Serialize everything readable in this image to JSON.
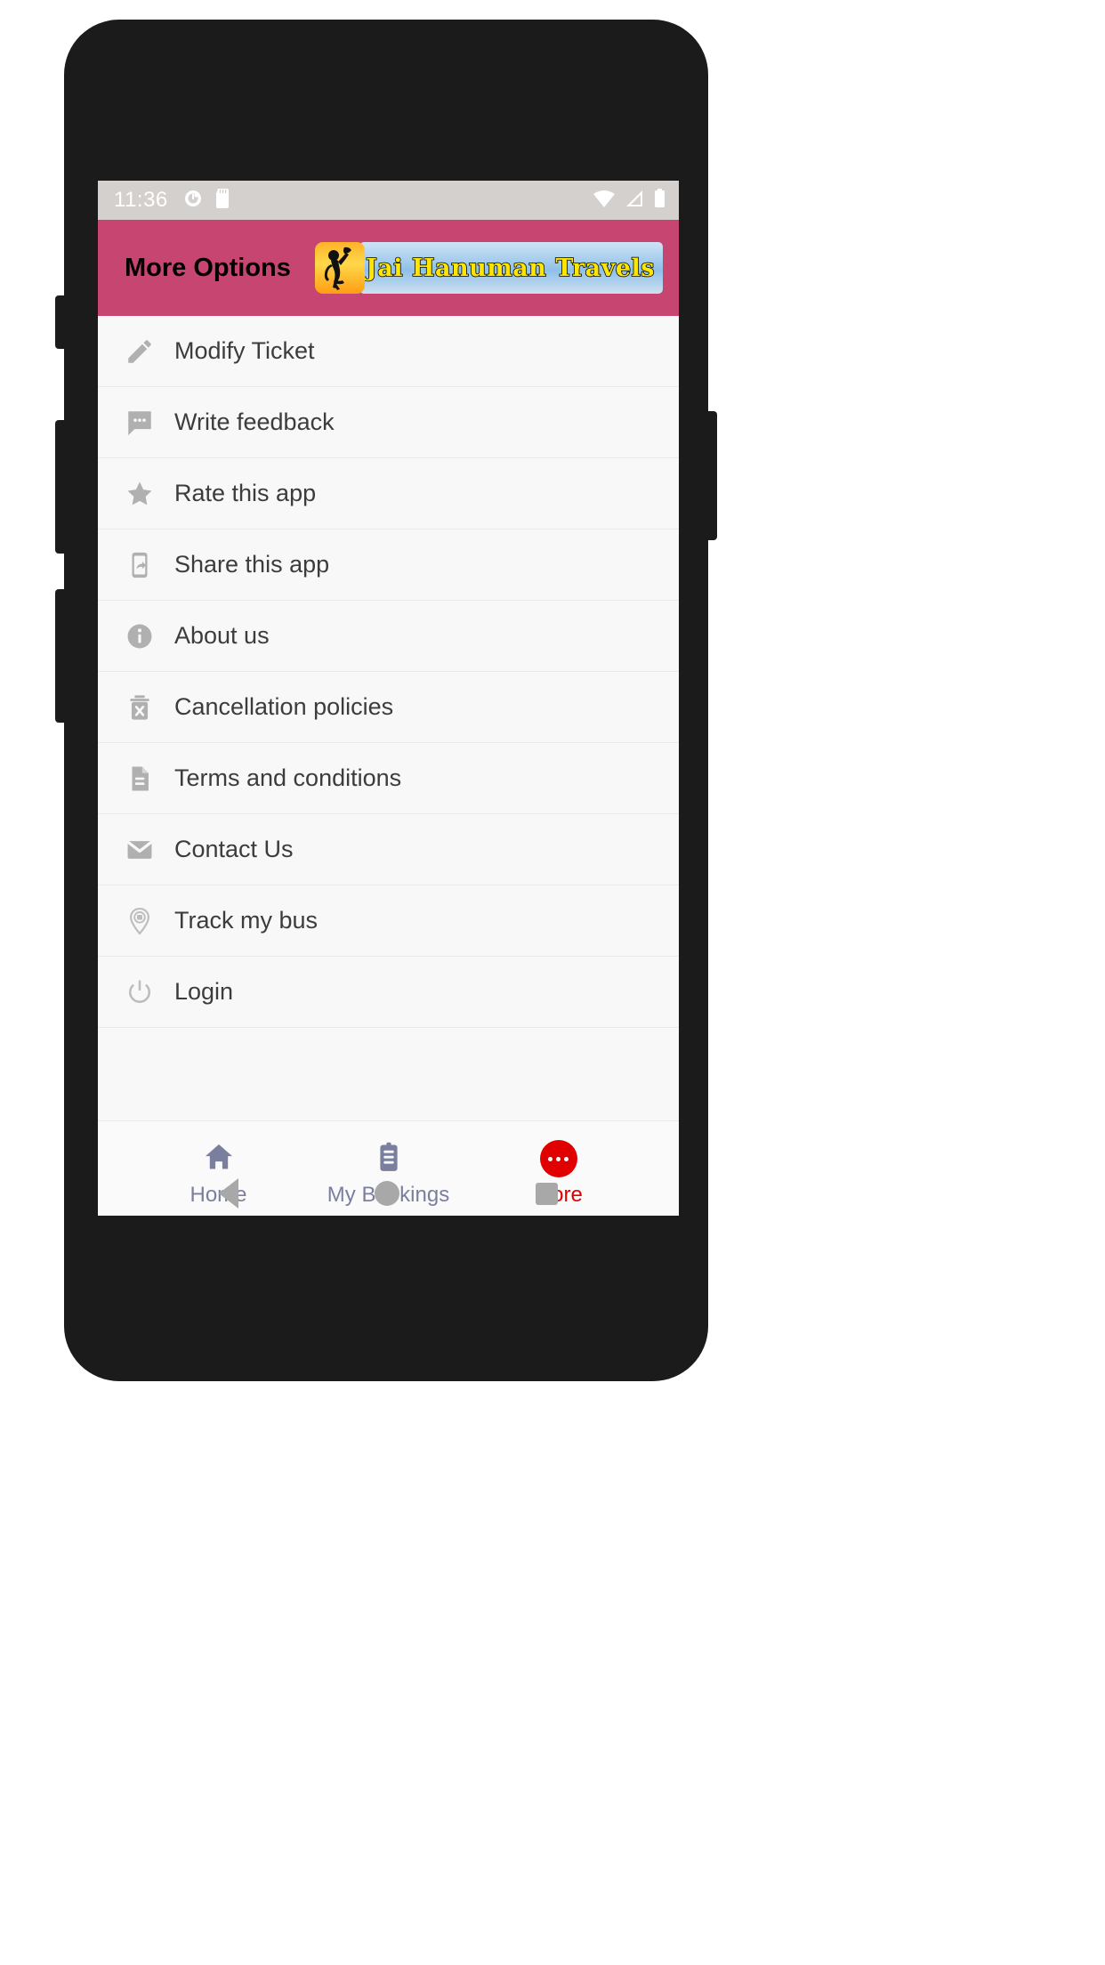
{
  "status_bar": {
    "time": "11:36",
    "left_icons": [
      "alarm-icon",
      "sd-card-icon"
    ],
    "right_icons": [
      "wifi-icon",
      "signal-icon",
      "battery-icon"
    ]
  },
  "app_bar": {
    "title": "More Options",
    "logo": {
      "brand_text": "Jai Hanuman Travels",
      "badge_icon": "hanuman-silhouette-icon"
    },
    "background_color": "#c64671"
  },
  "menu": {
    "items": [
      {
        "label": "Modify Ticket",
        "icon": "pencil-icon"
      },
      {
        "label": "Write feedback",
        "icon": "chat-bubble-icon"
      },
      {
        "label": "Rate this app",
        "icon": "star-icon"
      },
      {
        "label": "Share this app",
        "icon": "phone-share-icon"
      },
      {
        "label": "About us",
        "icon": "info-icon"
      },
      {
        "label": "Cancellation policies",
        "icon": "trash-x-icon"
      },
      {
        "label": "Terms and conditions",
        "icon": "document-icon"
      },
      {
        "label": "Contact Us",
        "icon": "envelope-icon"
      },
      {
        "label": "Track my bus",
        "icon": "map-pin-bus-icon"
      },
      {
        "label": "Login",
        "icon": "power-icon"
      }
    ]
  },
  "bottom_nav": {
    "items": [
      {
        "label": "Home",
        "icon": "home-icon",
        "active": false
      },
      {
        "label": "My Bookings",
        "icon": "clipboard-icon",
        "active": false
      },
      {
        "label": "More",
        "icon": "more-dots-icon",
        "active": true
      }
    ],
    "active_color": "#e00000",
    "inactive_color": "#7b7f9e"
  },
  "android_nav": {
    "back": "back-triangle-icon",
    "home": "home-circle-icon",
    "recents": "recents-square-icon"
  }
}
